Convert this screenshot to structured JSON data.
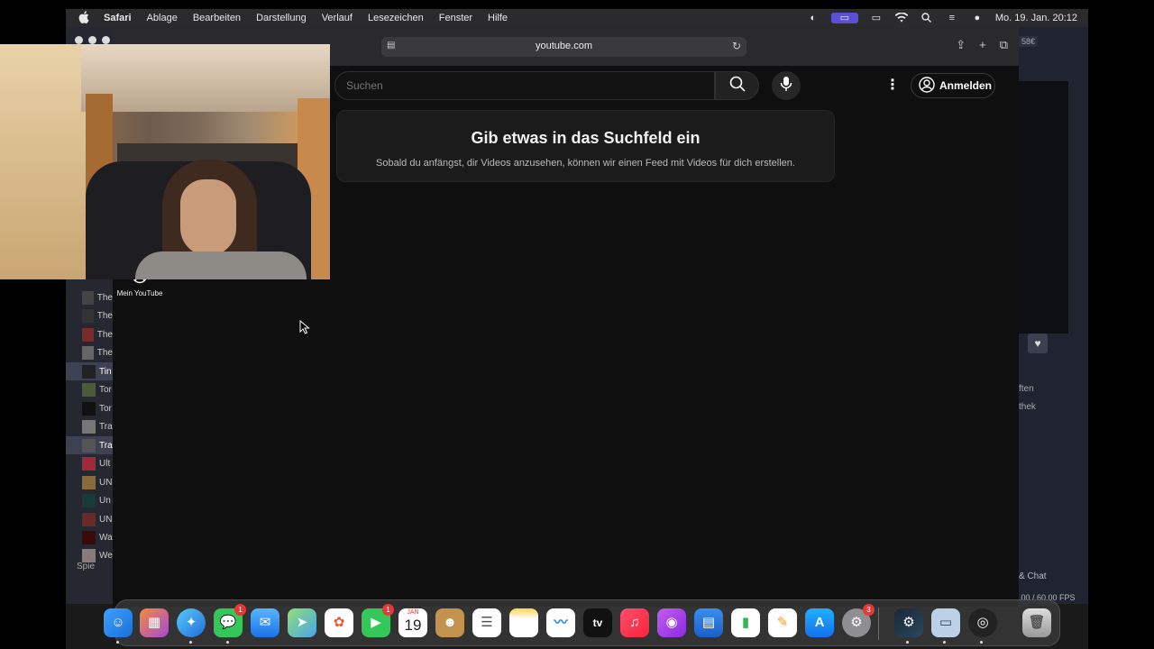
{
  "menubar": {
    "apple": "",
    "app": "Safari",
    "items": [
      "Ablage",
      "Bearbeiten",
      "Darstellung",
      "Verlauf",
      "Lesezeichen",
      "Fenster",
      "Hilfe"
    ],
    "datetime": "Mo. 19. Jan. 20:12"
  },
  "browser": {
    "url": "youtube.com"
  },
  "youtube": {
    "search_placeholder": "Suchen",
    "signin_label": "Anmelden",
    "empty_title": "Gib etwas in das Suchfeld ein",
    "empty_text": "Sobald du anfängst, dir Videos anzusehen, können wir einen Feed mit Videos für dich erstellen.",
    "sidebar_my_youtube": "Mein YouTube"
  },
  "background_window": {
    "list_rows": [
      "The",
      "The",
      "The",
      "The",
      "Tin",
      "Tor",
      "Tor",
      "Tra",
      "Tra",
      "Ult",
      "UN",
      "Un",
      "UN",
      "Wa",
      "We"
    ],
    "spiel_label": "Spie",
    "price": "58€",
    "text_a": "ften",
    "text_b": "thek",
    "chat": "& Chat",
    "fps": ".00 / 60.00 FPS"
  },
  "dock": {
    "calendar_month": "JAN",
    "calendar_day": "19",
    "messages_badge": "1",
    "facetime_badge": "1",
    "settings_badge": "3",
    "appletv_label": "tv"
  }
}
